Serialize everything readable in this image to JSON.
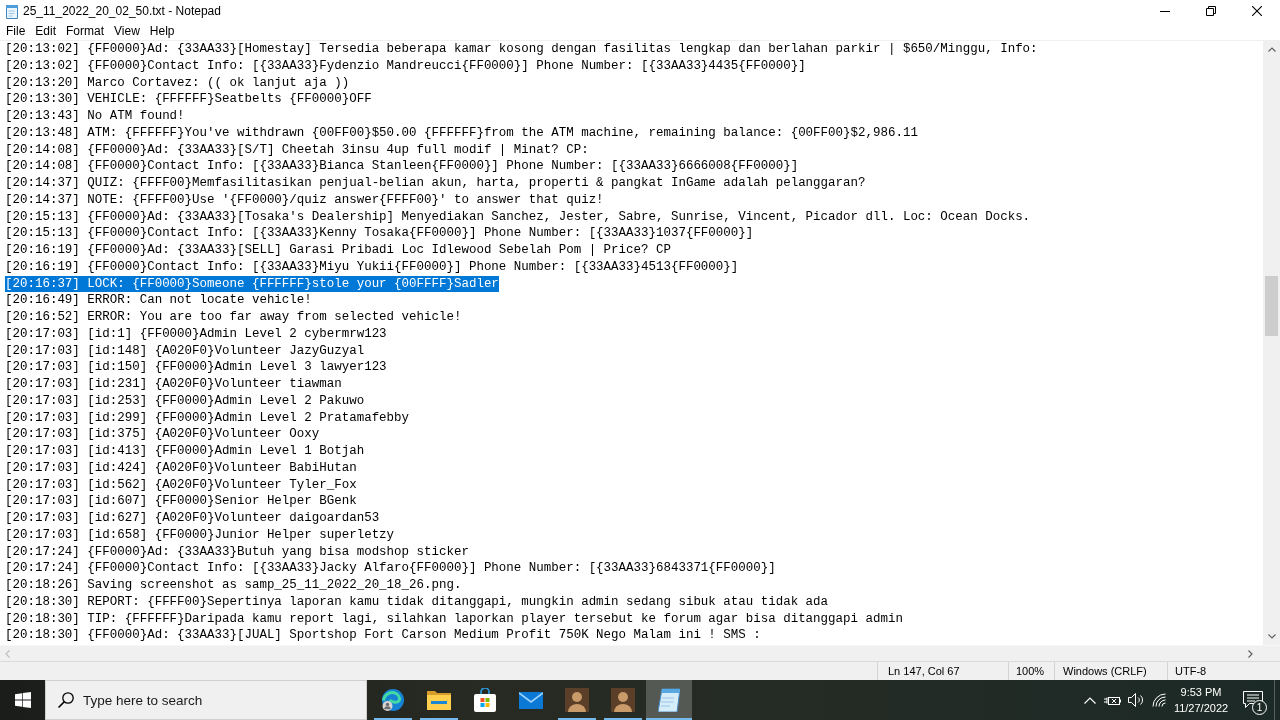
{
  "window": {
    "title": "25_11_2022_20_02_50.txt - Notepad"
  },
  "menu": [
    "File",
    "Edit",
    "Format",
    "View",
    "Help"
  ],
  "editor": {
    "lines": [
      {
        "text": "[20:13:02] {FF0000}Ad: {33AA33}[Homestay] Tersedia beberapa kamar kosong dengan fasilitas lengkap dan berlahan parkir | $650/Minggu, Info:",
        "selected": false
      },
      {
        "text": "[20:13:02] {FF0000}Contact Info: [{33AA33}Fydenzio Mandreucci{FF0000}] Phone Number: [{33AA33}4435{FF0000}]",
        "selected": false
      },
      {
        "text": "[20:13:20] Marco Cortavez: (( ok lanjut aja ))",
        "selected": false
      },
      {
        "text": "[20:13:30] VEHICLE: {FFFFFF}Seatbelts {FF0000}OFF",
        "selected": false
      },
      {
        "text": "[20:13:43] No ATM found!",
        "selected": false
      },
      {
        "text": "[20:13:48] ATM: {FFFFFF}You've withdrawn {00FF00}$50.00 {FFFFFF}from the ATM machine, remaining balance: {00FF00}$2,986.11",
        "selected": false
      },
      {
        "text": "[20:14:08] {FF0000}Ad: {33AA33}[S/T] Cheetah 3insu 4up full modif | Minat? CP:",
        "selected": false
      },
      {
        "text": "[20:14:08] {FF0000}Contact Info: [{33AA33}Bianca Stanleen{FF0000}] Phone Number: [{33AA33}6666008{FF0000}]",
        "selected": false
      },
      {
        "text": "[20:14:37] QUIZ: {FFFF00}Memfasilitasikan penjual-belian akun, harta, properti & pangkat InGame adalah pelanggaran?",
        "selected": false
      },
      {
        "text": "[20:14:37] NOTE: {FFFF00}Use '{FF0000}/quiz answer{FFFF00}' to answer that quiz!",
        "selected": false
      },
      {
        "text": "[20:15:13] {FF0000}Ad: {33AA33}[Tosaka's Dealership] Menyediakan Sanchez, Jester, Sabre, Sunrise, Vincent, Picador dll. Loc: Ocean Docks.",
        "selected": false
      },
      {
        "text": "[20:15:13] {FF0000}Contact Info: [{33AA33}Kenny Tosaka{FF0000}] Phone Number: [{33AA33}1037{FF0000}]",
        "selected": false
      },
      {
        "text": "[20:16:19] {FF0000}Ad: {33AA33}[SELL] Garasi Pribadi Loc Idlewood Sebelah Pom | Price? CP",
        "selected": false
      },
      {
        "text": "[20:16:19] {FF0000}Contact Info: [{33AA33}Miyu Yukii{FF0000}] Phone Number: [{33AA33}4513{FF0000}]",
        "selected": false
      },
      {
        "text": "[20:16:37] LOCK: {FF0000}Someone {FFFFFF}stole your {00FFFF}Sadler",
        "selected": true
      },
      {
        "text": "[20:16:49] ERROR: Can not locate vehicle!",
        "selected": false
      },
      {
        "text": "[20:16:52] ERROR: You are too far away from selected vehicle!",
        "selected": false
      },
      {
        "text": "[20:17:03] [id:1] {FF0000}Admin Level 2 cybermrw123",
        "selected": false
      },
      {
        "text": "[20:17:03] [id:148] {A020F0}Volunteer JazyGuzyal",
        "selected": false
      },
      {
        "text": "[20:17:03] [id:150] {FF0000}Admin Level 3 lawyer123",
        "selected": false
      },
      {
        "text": "[20:17:03] [id:231] {A020F0}Volunteer tiawman",
        "selected": false
      },
      {
        "text": "[20:17:03] [id:253] {FF0000}Admin Level 2 Pakuwo",
        "selected": false
      },
      {
        "text": "[20:17:03] [id:299] {FF0000}Admin Level 2 Pratamafebby",
        "selected": false
      },
      {
        "text": "[20:17:03] [id:375] {A020F0}Volunteer Ooxy",
        "selected": false
      },
      {
        "text": "[20:17:03] [id:413] {FF0000}Admin Level 1 Botjah",
        "selected": false
      },
      {
        "text": "[20:17:03] [id:424] {A020F0}Volunteer BabiHutan",
        "selected": false
      },
      {
        "text": "[20:17:03] [id:562] {A020F0}Volunteer Tyler_Fox",
        "selected": false
      },
      {
        "text": "[20:17:03] [id:607] {FF0000}Senior Helper BGenk",
        "selected": false
      },
      {
        "text": "[20:17:03] [id:627] {A020F0}Volunteer daigoardan53",
        "selected": false
      },
      {
        "text": "[20:17:03] [id:658] {FF0000}Junior Helper superletzy",
        "selected": false
      },
      {
        "text": "[20:17:24] {FF0000}Ad: {33AA33}Butuh yang bisa modshop sticker",
        "selected": false
      },
      {
        "text": "[20:17:24] {FF0000}Contact Info: [{33AA33}Jacky Alfaro{FF0000}] Phone Number: [{33AA33}6843371{FF0000}]",
        "selected": false
      },
      {
        "text": "[20:18:26] Saving screenshot as samp_25_11_2022_20_18_26.png.",
        "selected": false
      },
      {
        "text": "[20:18:30] REPORT: {FFFF00}Sepertinya laporan kamu tidak ditanggapi, mungkin admin sedang sibuk atau tidak ada",
        "selected": false
      },
      {
        "text": "[20:18:30] TIP: {FFFFFF}Daripada kamu report lagi, silahkan laporkan player tersebut ke forum agar bisa ditanggapi admin",
        "selected": false
      },
      {
        "text": "[20:18:30] {FF0000}Ad: {33AA33}[JUAL] Sportshop Fort Carson Medium Profit 750K Nego Malam ini ! SMS :",
        "selected": false
      }
    ]
  },
  "status_bar": {
    "position": "Ln 147, Col 67",
    "zoom": "100%",
    "line_ending": "Windows (CRLF)",
    "encoding": "UTF-8"
  },
  "taskbar": {
    "search": {
      "placeholder": "Type here to search"
    },
    "apps": [
      {
        "kind": "browser",
        "running": true,
        "active": false
      },
      {
        "kind": "folder",
        "running": true,
        "active": false
      },
      {
        "kind": "store",
        "running": false,
        "active": false
      },
      {
        "kind": "mail",
        "running": false,
        "active": false
      },
      {
        "kind": "portrait",
        "running": true,
        "active": false
      },
      {
        "kind": "portrait",
        "running": true,
        "active": false
      },
      {
        "kind": "notepad",
        "running": true,
        "active": true
      }
    ],
    "tray": {
      "time": "9:53 PM",
      "date": "11/27/2022",
      "notification_count": "1"
    }
  }
}
